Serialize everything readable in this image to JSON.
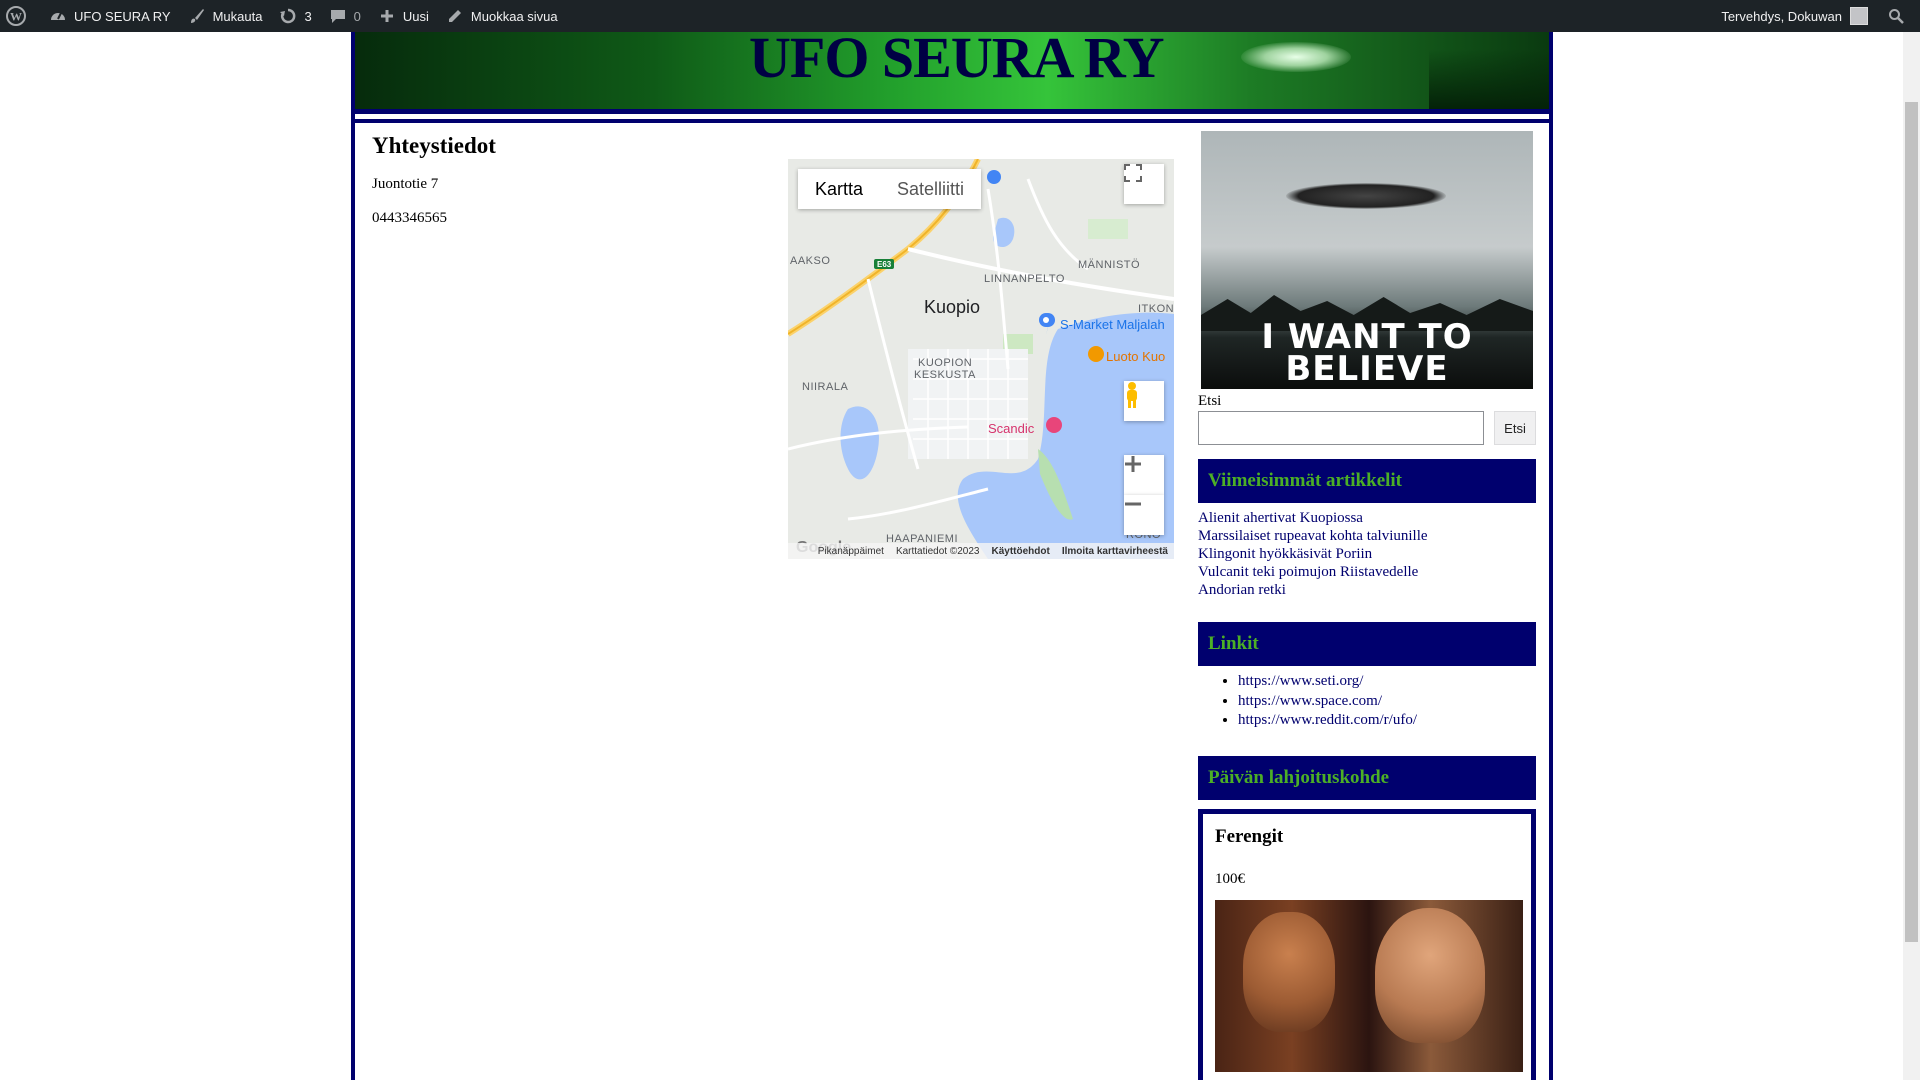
{
  "adminbar": {
    "site_name": "UFO SEURA RY",
    "customize": "Mukauta",
    "updates_count": "3",
    "comments_count": "0",
    "new": "Uusi",
    "edit_page": "Muokkaa sivua",
    "greeting": "Tervehdys, Dokuwan",
    "icons": [
      "wordpress-icon",
      "dashboard-icon",
      "brush-icon",
      "updates-icon",
      "comment-icon",
      "plus-icon",
      "pencil-icon",
      "search-icon"
    ]
  },
  "banner": {
    "title": "UFO SEURA RY"
  },
  "main": {
    "title": "Yhteystiedot",
    "address": "Juontotie 7",
    "phone": "0443346565"
  },
  "map": {
    "tab_map": "Kartta",
    "tab_satellite": "Satelliitti",
    "labels": {
      "city": "Kuopio",
      "linnanpelto": "LINNANPELTO",
      "mannisto": "MÄNNISTÖ",
      "aakso": "AAKSO",
      "itkon": "ITKON",
      "center1": "KUOPION",
      "center2": "KESKUSTA",
      "niirala": "NIIRALA",
      "haapaniemi": "HAAPANIEMI",
      "rono": "RONO",
      "smarket": "S-Market Maljalah",
      "luoto": "Luoto Kuo",
      "scandic": "Scandic",
      "e63": "E63"
    },
    "footer": {
      "shortcuts": "Pikanäppäimet",
      "mapdata": "Karttatiedot ©2023",
      "terms": "Käyttöehdot",
      "report": "Ilmoita karttavirheestä"
    },
    "google": "Google"
  },
  "sidebar": {
    "poster_text": "I WANT TO BELIEVE",
    "search_label": "Etsi",
    "search_button": "Etsi",
    "search_value": "",
    "recent_title": "Viimeisimmät artikkelit",
    "recent": [
      "Alienit ahertivat Kuopiossa",
      "Marssilaiset rupeavat kohta talviunille",
      "Klingonit hyökkäsivät Poriin",
      "Vulcanit teki poimujon Riistavedelle",
      "Andorian retki"
    ],
    "links_title": "Linkit",
    "links": [
      "https://www.seti.org/",
      "https://www.space.com/",
      "https://www.reddit.com/r/ufo/"
    ],
    "donation_title": "Päivän lahjoituskohde",
    "donation_name": "Ferengit",
    "donation_amount": "100€"
  },
  "colors": {
    "adminbar": "#1d2327",
    "navy": "#00006e",
    "widget_text": "#4caf26"
  }
}
